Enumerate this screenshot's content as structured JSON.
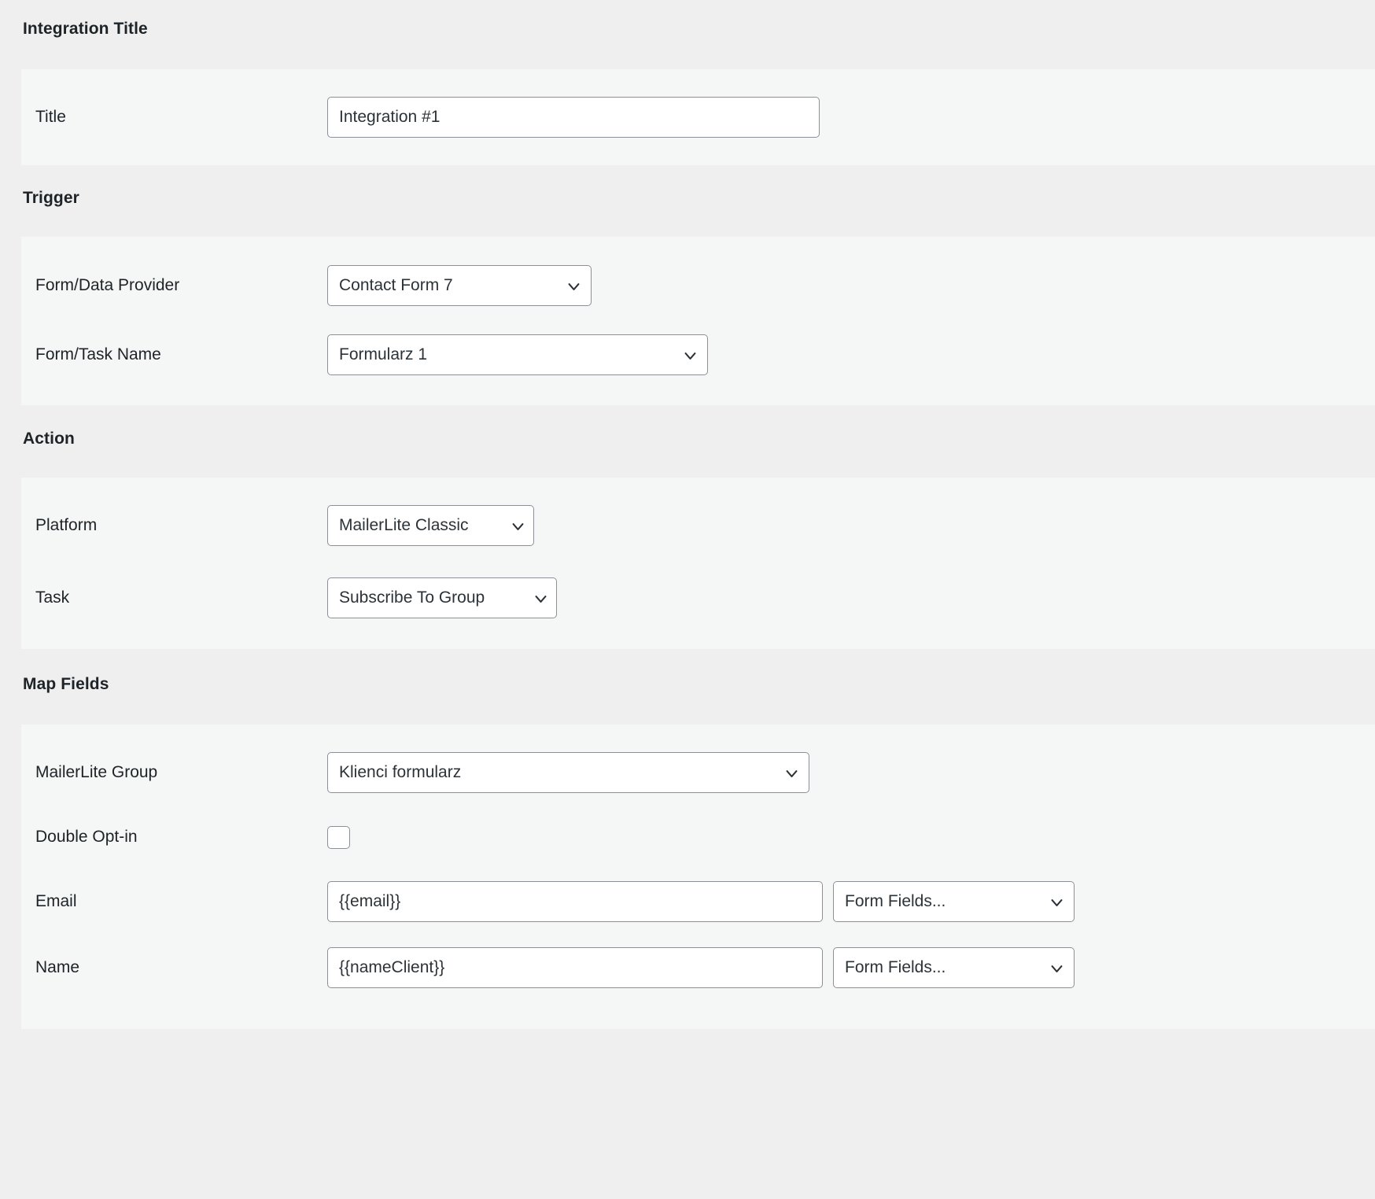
{
  "sections": {
    "integration_title": {
      "heading": "Integration Title",
      "fields": {
        "title": {
          "label": "Title",
          "value": "Integration #1",
          "placeholder": ""
        }
      }
    },
    "trigger": {
      "heading": "Trigger",
      "fields": {
        "provider": {
          "label": "Form/Data Provider",
          "value": "Contact Form 7",
          "options": [
            "Contact Form 7"
          ]
        },
        "task_name": {
          "label": "Form/Task Name",
          "value": "Formularz 1",
          "options": [
            "Formularz 1"
          ]
        }
      }
    },
    "action": {
      "heading": "Action",
      "fields": {
        "platform": {
          "label": "Platform",
          "value": "MailerLite Classic",
          "options": [
            "MailerLite Classic"
          ]
        },
        "task": {
          "label": "Task",
          "value": "Subscribe To Group",
          "options": [
            "Subscribe To Group"
          ]
        }
      }
    },
    "map_fields": {
      "heading": "Map Fields",
      "fields": {
        "group": {
          "label": "MailerLite Group",
          "value": "Klienci formularz",
          "options": [
            "Klienci formularz"
          ]
        },
        "double_optin": {
          "label": "Double Opt-in",
          "checked": false
        },
        "email": {
          "label": "Email",
          "value": "{{email}}",
          "placeholder": "",
          "form_fields_select": {
            "value": "Form Fields...",
            "options": [
              "Form Fields..."
            ]
          }
        },
        "name": {
          "label": "Name",
          "value": "{{nameClient}}",
          "placeholder": "",
          "form_fields_select": {
            "value": "Form Fields...",
            "options": [
              "Form Fields..."
            ]
          }
        }
      }
    }
  },
  "icons": {
    "chevron_down": "chevron-down-icon"
  },
  "colors": {
    "page_background": "#efefef",
    "panel_background": "#f5f6f6",
    "text": "#1d2327",
    "border": "#8c8f94",
    "input_background": "#ffffff"
  }
}
